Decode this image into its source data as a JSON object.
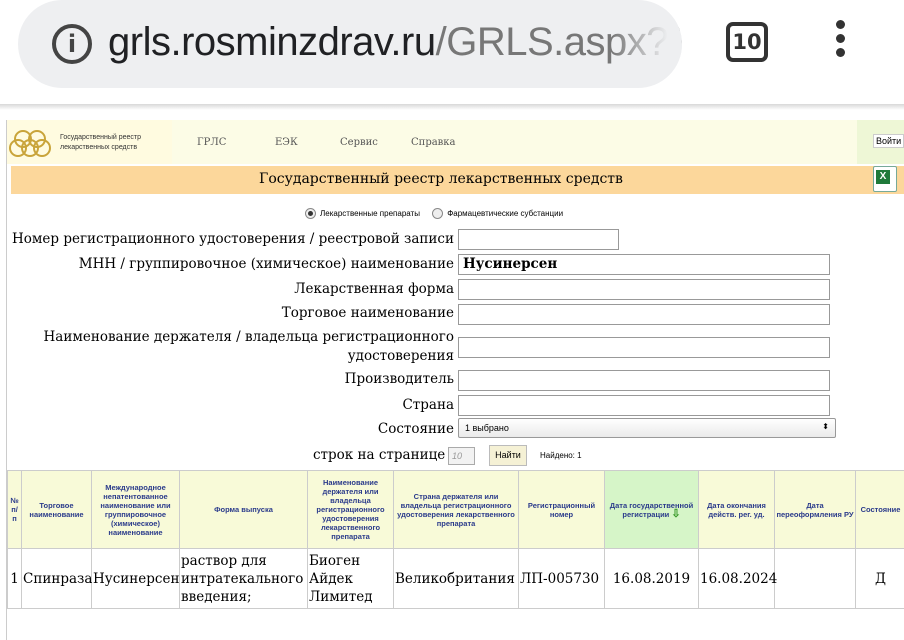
{
  "browser": {
    "url_domain": "grls.rosminzdrav.ru",
    "url_path": "/GRLS.aspx?Re",
    "tab_count": "10",
    "info_icon": "i"
  },
  "header": {
    "site_title_line1": "Государственный реестр",
    "site_title_line2": "лекарственных средств",
    "nav": [
      "ГРЛС",
      "ЕЭК",
      "Сервис",
      "Справка"
    ],
    "login_label": "Войти",
    "banner_title": "Государственный реестр лекарственных средств",
    "excel_icon_letter": "X"
  },
  "search": {
    "radio_drugs": "Лекарственные препараты",
    "radio_substances": "Фармацевтические субстанции",
    "fields": {
      "reg_number_label": "Номер регистрационного удостоверения / реестровой записи",
      "reg_number_value": "",
      "inn_label": "МНН / группировочное (химическое) наименование",
      "inn_value": "Нусинерсен",
      "form_label": "Лекарственная форма",
      "form_value": "",
      "trade_label": "Торговое наименование",
      "trade_value": "",
      "holder_label_line1": "Наименование держателя / владельца регистрационного",
      "holder_label_line2": "удостоверения",
      "holder_value": "",
      "manufacturer_label": "Производитель",
      "manufacturer_value": "",
      "country_label": "Страна",
      "country_value": "",
      "state_label": "Состояние",
      "state_value": "1 выбрано"
    },
    "rows_label": "строк на странице",
    "rows_value": "10",
    "find_button": "Найти",
    "found_text": "Найдено: 1"
  },
  "table": {
    "headers": [
      "№ п/п",
      "Торговое наименование",
      "Международное непатентованное наименование или группировочное (химическое) наименование",
      "Форма выпуска",
      "Наименование держателя или владельца регистрационного удостоверения лекарственного препарата",
      "Страна держателя или владельца регистрационного удостоверения лекарственного препарата",
      "Регистрационный номер",
      "Дата государственной регистрации",
      "Дата окончания действ. рег. уд.",
      "Дата переоформления РУ",
      "Состояние"
    ],
    "sort_arrow": "⇩",
    "rows": [
      [
        "1",
        "Спинраза",
        "Нусинерсен",
        "раствор для интратекального введения;",
        "Биоген Айдек Лимитед",
        "Великобритания",
        "ЛП-005730",
        "16.08.2019",
        "16.08.2024",
        "",
        "Д"
      ]
    ]
  }
}
